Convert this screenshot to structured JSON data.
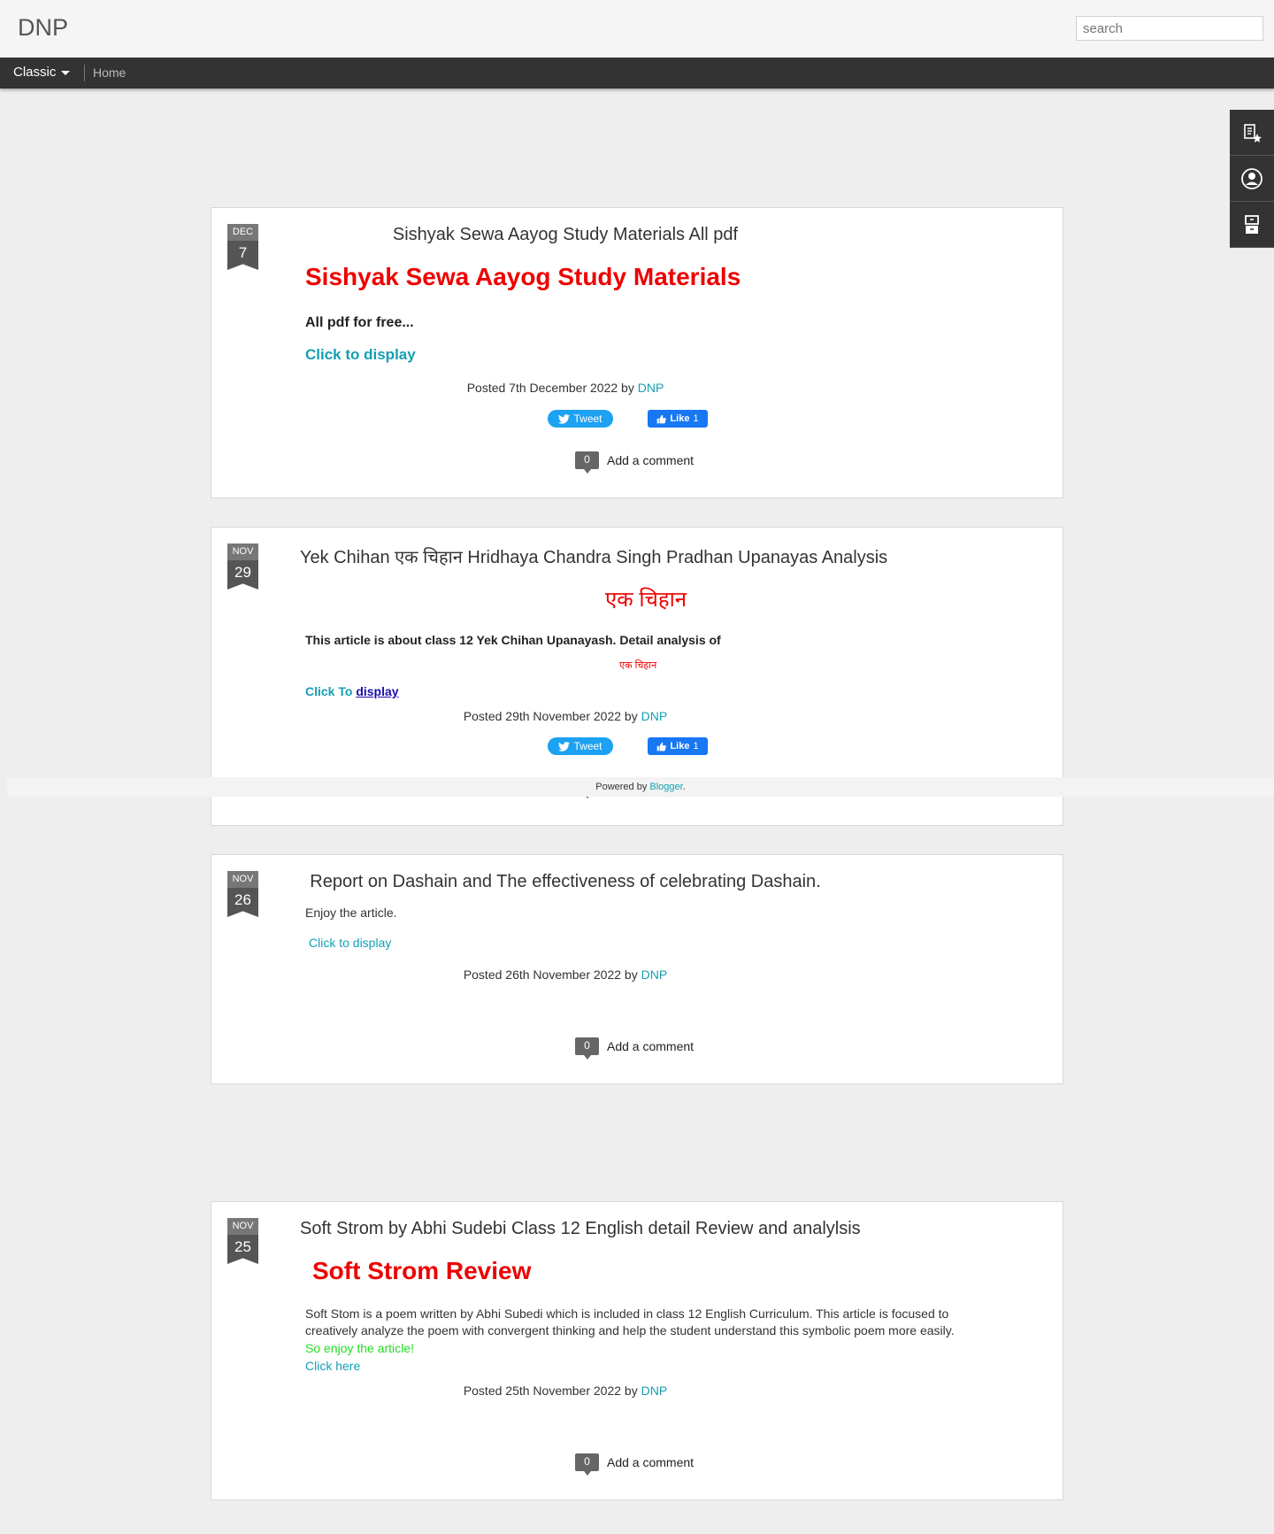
{
  "header": {
    "blog_title": "DNP",
    "search_placeholder": "search"
  },
  "nav": {
    "classic_label": "Classic",
    "home_label": "Home"
  },
  "posts": [
    {
      "month": "DEC",
      "day": "7",
      "title": "Sishyak Sewa Aayog Study Materials All pdf",
      "heading": "Sishyak Sewa Aayog Study Materials",
      "subtext": "All pdf for free...",
      "link_label": "Click to display",
      "posted": "Posted 7th December 2022 by",
      "author": "DNP",
      "tweet_label": "Tweet",
      "like_label": "Like",
      "like_count": "1",
      "comment_count": "0",
      "comment_label": "Add a comment"
    },
    {
      "month": "NOV",
      "day": "29",
      "title": "Yek Chihan एक चिहान Hridhaya Chandra Singh Pradhan Upanayas Analysis",
      "heading": "एक चिहान",
      "subtext": "This article is about class 12 Yek Chihan Upanayash. Detail analysis of",
      "small_red": "एक चिहान",
      "link_prefix": "Click To",
      "link_label": "display",
      "posted": "Posted 29th November 2022 by",
      "author": "DNP",
      "tweet_label": "Tweet",
      "like_label": "Like",
      "like_count": "1"
    },
    {
      "month": "NOV",
      "day": "26",
      "title": "Report on Dashain and The effectiveness of celebrating Dashain.",
      "body": "Enjoy the article.",
      "link_label": "Click to display",
      "posted": "Posted 26th November 2022 by",
      "author": "DNP",
      "comment_count": "0",
      "comment_label": "Add a comment"
    },
    {
      "month": "NOV",
      "day": "25",
      "title": "Soft Strom by Abhi Sudebi Class 12 English detail Review and analylsis",
      "heading": "Soft Strom Review",
      "body_line1": "Soft Stom is  a poem written by Abhi Subedi which is included in class 12 English Curriculum. This article is focused to",
      "body_line2": "creatively analyze the poem with convergent thinking and help the student understand this symbolic poem more easily.",
      "enjoy": "So enjoy the article!",
      "link_label": "Click here",
      "posted": "Posted 25th November 2022 by",
      "author": "DNP",
      "comment_count": "0",
      "comment_label": "Add a comment"
    }
  ],
  "footer": {
    "powered_prefix": "Powered by",
    "powered_link": "Blogger",
    "powered_suffix": "."
  },
  "icons": [
    "posts-icon",
    "profile-icon",
    "archive-icon",
    "twitter-bird-icon",
    "thumbs-up-icon"
  ],
  "colors": {
    "accent": "#139fb3",
    "heading_red": "#ee0000",
    "enjoy_green": "#22dd22",
    "navbar": "#333333",
    "background": "#eeeeee"
  }
}
